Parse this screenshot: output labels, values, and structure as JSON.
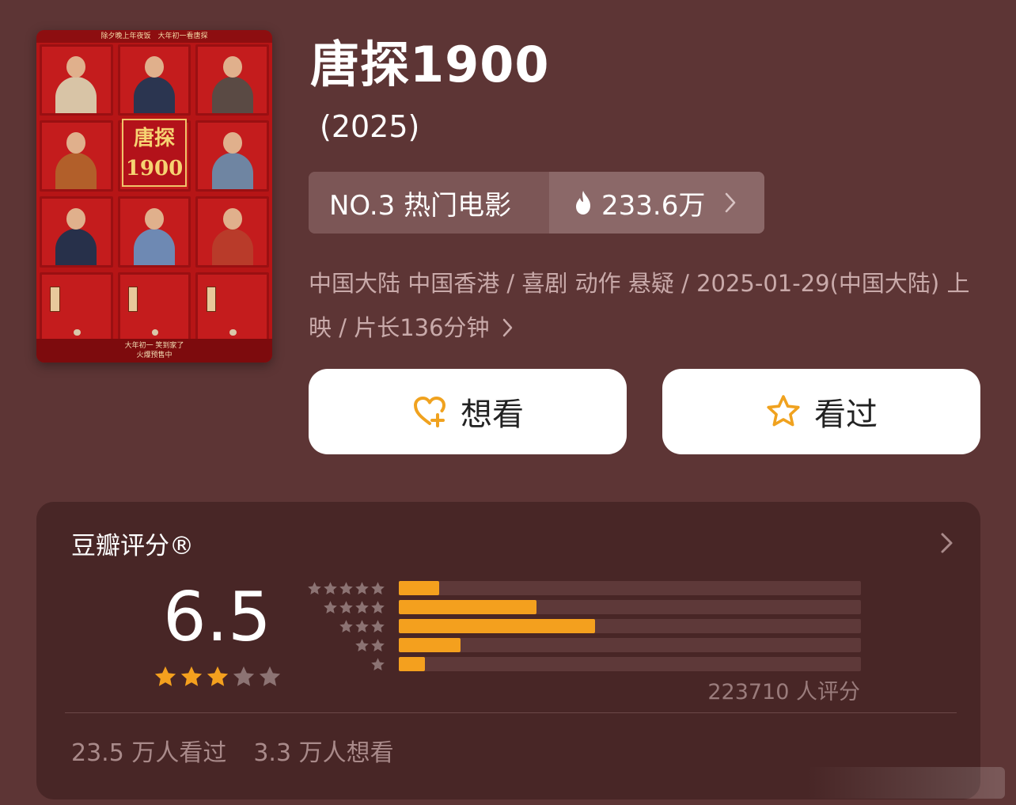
{
  "poster": {
    "top_text": "除夕晚上年夜饭　大年初一看唐探",
    "title_text": "唐探 1900",
    "bottom_text": "大年初一 笑到家了",
    "bottom_sub": "火爆预售中"
  },
  "movie": {
    "title": "唐探1900",
    "year": "(2025)"
  },
  "rank": {
    "label": "NO.3 热门电影",
    "heat": "233.6万",
    "heat_icon": "flame-icon"
  },
  "meta": {
    "line": "中国大陆 中国香港 / 喜剧 动作 悬疑 / 2025-01-29(中国大陆) 上映 / 片长136分钟"
  },
  "actions": {
    "want_label": "想看",
    "seen_label": "看过",
    "want_icon": "heart-plus-icon",
    "seen_icon": "star-outline-icon"
  },
  "rating": {
    "title": "豆瓣评分®",
    "score": "6.5",
    "score_stars": 3,
    "distribution": [
      {
        "stars": 5,
        "fraction": 0.087
      },
      {
        "stars": 4,
        "fraction": 0.298
      },
      {
        "stars": 3,
        "fraction": 0.425
      },
      {
        "stars": 2,
        "fraction": 0.134
      },
      {
        "stars": 1,
        "fraction": 0.056
      }
    ],
    "raters_label": "223710 人评分",
    "seen_count": "23.5 万人看过",
    "want_count": "3.3 万人想看"
  },
  "colors": {
    "background": "#5d3535",
    "card": "#482626",
    "accent_orange": "#f4a01e",
    "star_empty": "#8c7373"
  }
}
